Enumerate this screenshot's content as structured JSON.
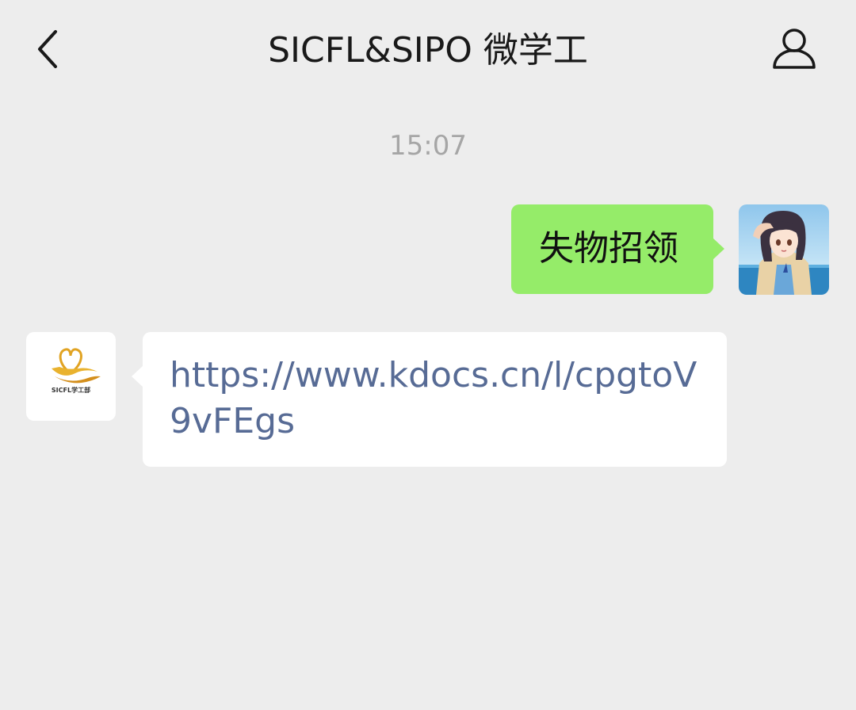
{
  "header": {
    "title": "SICFL&SIPO 微学工",
    "back_icon": "chevron-left-icon",
    "profile_icon": "user-icon"
  },
  "chat": {
    "timestamp": "15:07",
    "messages": [
      {
        "sender": "me",
        "text": "失物招领"
      },
      {
        "sender": "account",
        "text": "https://www.kdocs.cn/l/cpgtoV9vFEgs"
      }
    ]
  },
  "account_logo": {
    "caption": "SICFL学工部"
  },
  "colors": {
    "background": "#ededed",
    "my_bubble": "#95ec69",
    "other_bubble": "#ffffff",
    "link": "#576b95",
    "timestamp": "#a6a6a6"
  }
}
